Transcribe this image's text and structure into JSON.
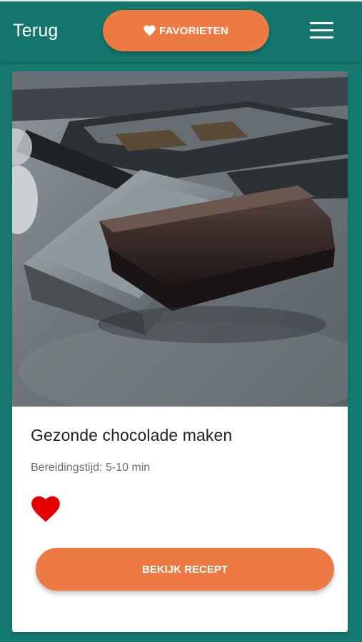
{
  "header": {
    "back_label": "Terug",
    "favorites_label": "FAVORIETEN",
    "favorites_icon": "heart-icon",
    "menu_icon": "hamburger-menu-icon"
  },
  "recipe": {
    "title": "Gezonde chocolade maken",
    "prep_time": "Bereidingstijd: 5-10 min",
    "image_alt": "Chocolate bar in a metal mould",
    "liked": true,
    "like_icon": "heart-icon",
    "button_label": "BEKIJK RECEPT"
  },
  "colors": {
    "background": "#16796f",
    "accent": "#ee7a43",
    "heart": "#e50000",
    "card": "#ffffff"
  }
}
